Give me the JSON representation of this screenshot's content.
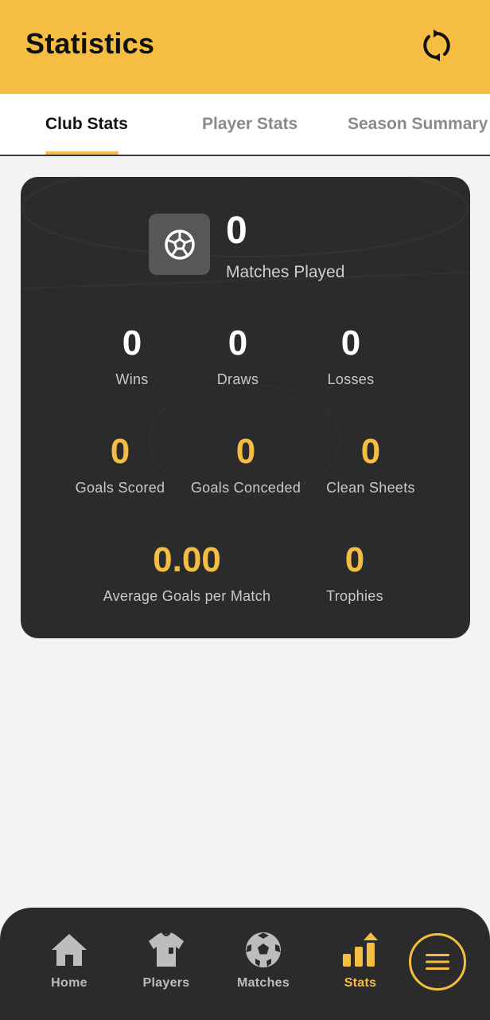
{
  "header": {
    "title": "Statistics",
    "refresh_icon": "refresh-icon"
  },
  "tabs": [
    {
      "label": "Club Stats",
      "active": true
    },
    {
      "label": "Player Stats",
      "active": false
    },
    {
      "label": "Season Summary",
      "active": false
    }
  ],
  "club_stats": {
    "matches_played": {
      "value": "0",
      "label": "Matches Played",
      "icon": "soccer-ball-icon"
    },
    "wins": {
      "value": "0",
      "label": "Wins"
    },
    "draws": {
      "value": "0",
      "label": "Draws"
    },
    "losses": {
      "value": "0",
      "label": "Losses"
    },
    "goals_scored": {
      "value": "0",
      "label": "Goals Scored"
    },
    "goals_conceded": {
      "value": "0",
      "label": "Goals Conceded"
    },
    "clean_sheets": {
      "value": "0",
      "label": "Clean Sheets"
    },
    "avg_goals": {
      "value": "0.00",
      "label": "Average Goals per Match"
    },
    "trophies": {
      "value": "0",
      "label": "Trophies"
    }
  },
  "bottom_nav": {
    "items": [
      {
        "label": "Home",
        "icon": "home-icon",
        "active": false
      },
      {
        "label": "Players",
        "icon": "jersey-icon",
        "active": false
      },
      {
        "label": "Matches",
        "icon": "soccer-ball-icon",
        "active": false
      },
      {
        "label": "Stats",
        "icon": "bar-chart-icon",
        "active": true
      }
    ],
    "menu_icon": "hamburger-menu-icon"
  },
  "colors": {
    "accent": "#f5bd42",
    "card_bg": "#2b2b2b",
    "page_bg": "#f3f3f3"
  }
}
